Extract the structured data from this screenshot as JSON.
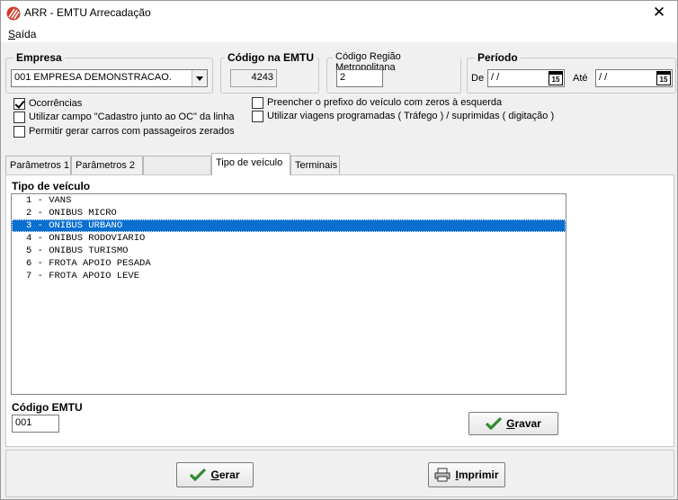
{
  "window": {
    "title": "ARR - EMTU Arrecadação",
    "close_glyph": "✕"
  },
  "menu": {
    "items": [
      {
        "label_mnemonic": "S",
        "label_rest": "aída"
      }
    ]
  },
  "empresa": {
    "legend": "Empresa",
    "selected": "001 EMPRESA DEMONSTRACAO."
  },
  "codigo_emtu_top": {
    "legend": "Código na EMTU",
    "value": "4243"
  },
  "regiao": {
    "legend": "Código Região Metropolitana",
    "value": "2"
  },
  "periodo": {
    "legend": "Período",
    "de_label": "De",
    "de_value": " / /",
    "ate_label": "Até",
    "ate_value": " / /",
    "calendar_text": "15"
  },
  "options": {
    "ocorrencias": {
      "label": "Ocorrências",
      "checked": true
    },
    "cadastro": {
      "label": "Utilizar campo \"Cadastro junto ao OC\" da linha",
      "checked": false
    },
    "passageiros": {
      "label": "Permitir gerar carros com passageiros zerados",
      "checked": false
    },
    "prefixo": {
      "label": "Preencher o prefixo do veículo com zeros à esquerda",
      "checked": false
    },
    "viagens": {
      "label": "Utilizar viagens programadas ( Tráfego ) / suprimidas ( digitação )",
      "checked": false
    }
  },
  "tabs": [
    {
      "label": "Parâmetros 1",
      "active": false
    },
    {
      "label": "Parâmetros 2",
      "active": false
    },
    {
      "label": "Tipo de veículo",
      "active": true
    },
    {
      "label": "Terminais",
      "active": false
    }
  ],
  "panel": {
    "title": "Tipo de veículo",
    "selected_index": 2,
    "items": [
      "1 - VANS",
      "2 - ONIBUS MICRO",
      "3 - ONIBUS URBANO",
      "4 - ONIBUS RODOVIARIO",
      "5 - ONIBUS TURISMO",
      "6 - FROTA APOIO PESADA",
      "7 - FROTA APOIO LEVE"
    ],
    "codigo_label": "Código EMTU",
    "codigo_value": "001",
    "gravar_mnemonic": "G",
    "gravar_rest": "ravar"
  },
  "footer": {
    "gerar_mnemonic": "G",
    "gerar_rest": "erar",
    "imprimir_mnemonic": "I",
    "imprimir_rest": "mprimir"
  },
  "colors": {
    "selection": "#0a6fd0",
    "check_green": "#2e8b2e",
    "brand_red": "#d23a2a"
  }
}
